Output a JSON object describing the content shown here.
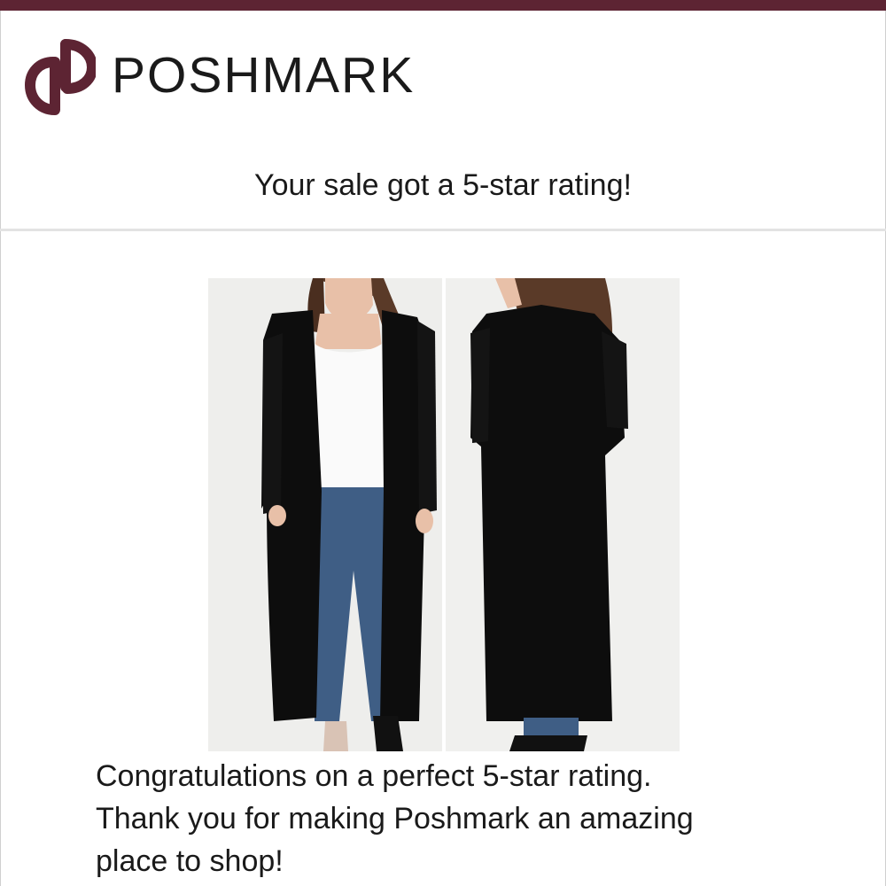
{
  "brand": {
    "name": "POSHMARK",
    "logo_icon": "poshmark-logo-icon",
    "accent_color": "#5d2433"
  },
  "notification": {
    "headline": "Your sale got a 5-star rating!"
  },
  "listing": {
    "image_icon": "cardigan-product-photo"
  },
  "message": {
    "lines": [
      "Congratulations on a perfect 5-star rating.",
      "Thank you for making Poshmark an amazing",
      "place to shop!"
    ]
  }
}
